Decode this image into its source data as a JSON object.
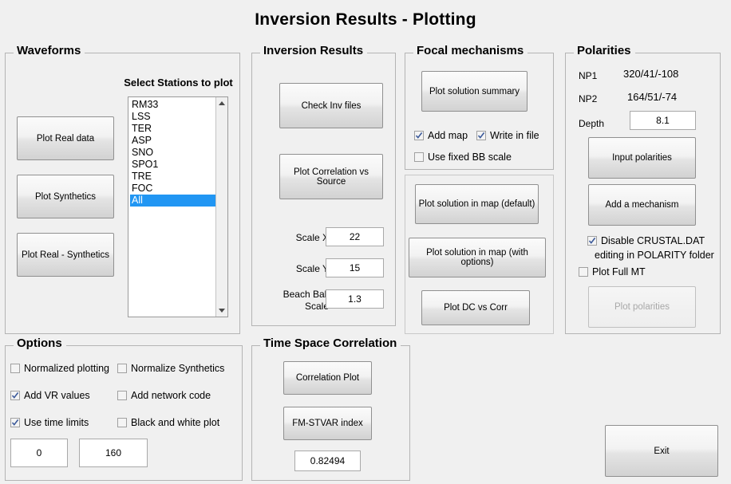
{
  "window": {
    "title": "Inversion Results  -  Plotting",
    "background_color": "#f0f0f0",
    "accent_color": "#2196f3"
  },
  "waveforms": {
    "title": "Waveforms",
    "buttons": [
      {
        "label": "Plot Real data"
      },
      {
        "label": "Plot Synthetics"
      },
      {
        "label": "Plot Real - Synthetics"
      }
    ],
    "station_list_label": "Select Stations to plot",
    "stations": [
      {
        "label": "RM33",
        "selected": false
      },
      {
        "label": "LSS",
        "selected": false
      },
      {
        "label": "TER",
        "selected": false
      },
      {
        "label": "ASP",
        "selected": false
      },
      {
        "label": "SNO",
        "selected": false
      },
      {
        "label": "SPO1",
        "selected": false
      },
      {
        "label": "TRE",
        "selected": false
      },
      {
        "label": "FOC",
        "selected": false
      },
      {
        "label": "All",
        "selected": true
      }
    ],
    "scroll_up_icon": "triangle-up-icon",
    "scroll_down_icon": "triangle-down-icon"
  },
  "inversion_results": {
    "title": "Inversion Results",
    "check_inv_files_label": "Check Inv files",
    "plot_correlation_label": "Plot Correlation vs Source",
    "scale_x_label": "Scale X",
    "scale_x_value": "22",
    "scale_y_label": "Scale Y",
    "scale_y_value": "15",
    "beach_ball_label_line1": "Beach Ball",
    "beach_ball_label_line2": "Scale",
    "beach_ball_value": "1.3"
  },
  "focal_mechanisms": {
    "title": "Focal mechanisms",
    "plot_solution_summary_label": "Plot solution summary",
    "checkboxes": [
      {
        "label": "Add map",
        "checked": true
      },
      {
        "label": "Write in file",
        "checked": true
      },
      {
        "label": "Use fixed BB scale",
        "checked": false
      }
    ],
    "plot_map_default_label": "Plot solution in map (default)",
    "plot_map_options_label": "Plot solution in map (with options)",
    "plot_dc_vs_corr_label": "Plot DC vs Corr"
  },
  "polarities": {
    "title": "Polarities",
    "np1_label": "NP1",
    "np1_value": "320/41/-108",
    "np2_label": "NP2",
    "np2_value": "164/51/-74",
    "depth_label": "Depth",
    "depth_value": "8.1",
    "input_polarities_label": "Input  polarities",
    "add_mechanism_label": "Add a mechanism",
    "disable_crustal_line1": "Disable CRUSTAL.DAT",
    "disable_crustal_line2": "editing in POLARITY  folder",
    "disable_crustal_checked": true,
    "plot_full_mt_label": "Plot Full MT",
    "plot_full_mt_checked": false,
    "plot_polarities_label": "Plot polarities",
    "plot_polarities_disabled": true
  },
  "options": {
    "title": "Options",
    "checkboxes": [
      {
        "label": "Normalized plotting",
        "checked": false
      },
      {
        "label": "Normalize Synthetics",
        "checked": false
      },
      {
        "label": "Add VR values",
        "checked": true
      },
      {
        "label": "Add network code",
        "checked": false
      },
      {
        "label": "Use time limits",
        "checked": true
      },
      {
        "label": "Black and white plot",
        "checked": false
      }
    ],
    "time_min_value": "0",
    "time_max_value": "160"
  },
  "time_space_correlation": {
    "title": "Time Space Correlation",
    "correlation_plot_label": "Correlation Plot",
    "fm_stvar_index_label": "FM-STVAR index",
    "index_value": "0.82494"
  },
  "exit": {
    "label": "Exit"
  }
}
